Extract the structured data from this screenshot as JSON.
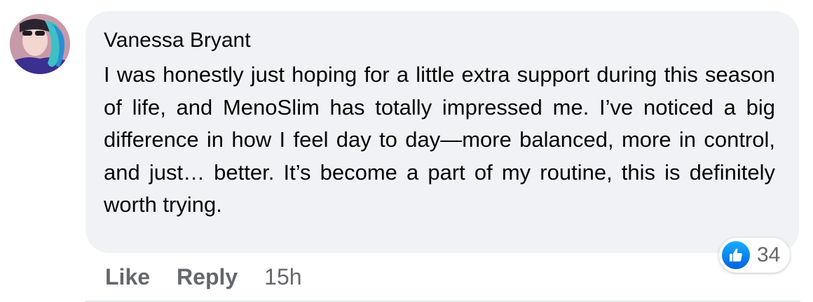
{
  "comment": {
    "author": "Vanessa Bryant",
    "text": "I was honestly just hoping for a little extra support during this season of life, and MenoSlim has totally impressed me. I’ve noticed a big difference in how I feel day to day—more balanced, more in control, and just… better. It’s become a part of my routine, this is definitely worth trying.",
    "actions": {
      "like_label": "Like",
      "reply_label": "Reply",
      "timestamp": "15h"
    },
    "reactions": {
      "icon": "thumbs-up-icon",
      "count": "34"
    }
  },
  "colors": {
    "bubble": "#f0f2f5",
    "text": "#050505",
    "secondary_text": "#65676b",
    "like_blue": "#0866ff"
  }
}
